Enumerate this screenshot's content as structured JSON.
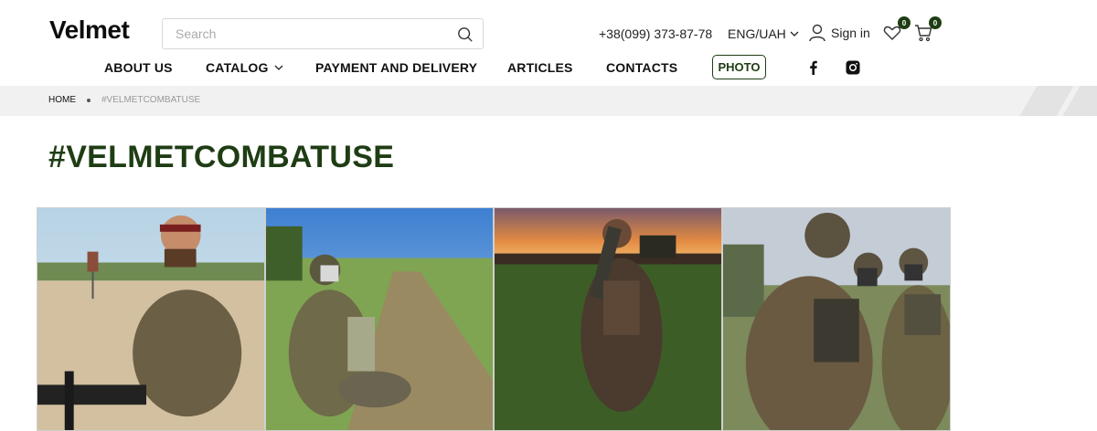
{
  "brand": {
    "logo_text": "Velmet",
    "accent_color": "#1f3d14"
  },
  "search": {
    "placeholder": "Search"
  },
  "contact": {
    "phone": "+38(099) 373-87-78"
  },
  "locale": {
    "label": "ENG/UAH"
  },
  "account": {
    "signin_label": "Sign in"
  },
  "wishlist": {
    "count": "0"
  },
  "cart": {
    "count": "0"
  },
  "nav": {
    "about": "ABOUT US",
    "catalog": "CATALOG",
    "payment": "PAYMENT AND DELIVERY",
    "articles": "ARTICLES",
    "contacts": "CONTACTS",
    "photo": "PHOTO"
  },
  "social": {
    "facebook_icon": "facebook-icon",
    "instagram_icon": "instagram-icon"
  },
  "breadcrumb": {
    "home": "HOME",
    "current": "#VELMETCOMBATUSE"
  },
  "page": {
    "title": "#VELMETCOMBATUSE"
  }
}
